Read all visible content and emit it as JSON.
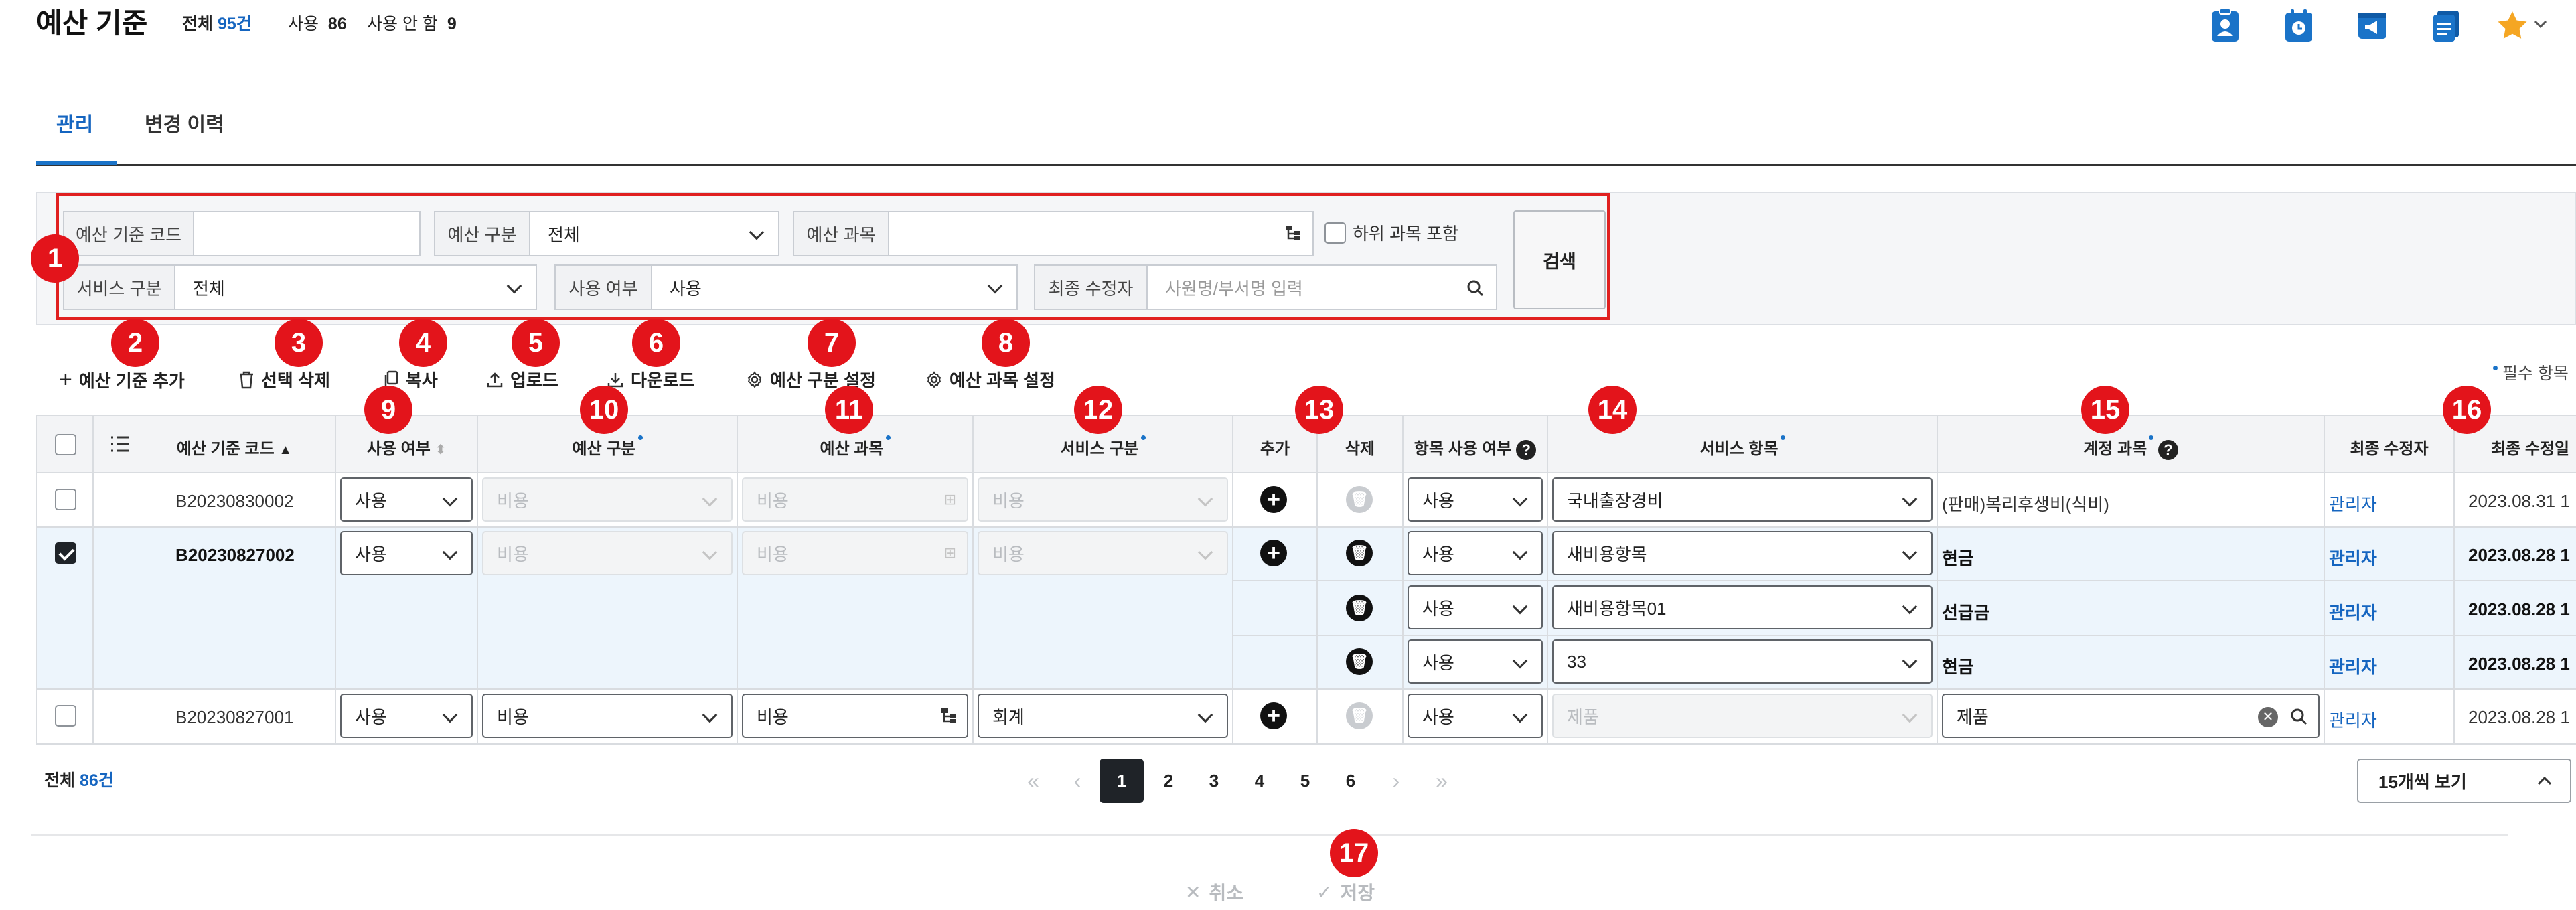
{
  "header": {
    "title": "예산 기준",
    "total_label": "전체",
    "total_value": "95건",
    "used_label": "사용",
    "used_value": "86",
    "unused_label": "사용 안 함",
    "unused_value": "9",
    "icons": [
      "person-badge-icon",
      "clock-calendar-icon",
      "megaphone-icon",
      "document-list-icon",
      "star-icon"
    ],
    "accent_color": "#1a73c8",
    "star_color": "#f5a623"
  },
  "tabs": [
    {
      "label": "관리",
      "active": true
    },
    {
      "label": "변경 이력",
      "active": false
    }
  ],
  "search": {
    "code_label": "예산 기준 코드",
    "code_value": "",
    "category_label": "예산 구분",
    "category_value": "전체",
    "account_label": "예산 과목",
    "account_value": "",
    "include_sub_label": "하위 과목 포함",
    "service_label": "서비스 구분",
    "service_value": "전체",
    "usage_label": "사용 여부",
    "usage_value": "사용",
    "modifier_label": "최종 수정자",
    "modifier_placeholder": "사원명/부서명 입력",
    "search_button": "검색"
  },
  "toolbar": {
    "add": "예산 기준 추가",
    "delete_selected": "선택 삭제",
    "copy": "복사",
    "upload": "업로드",
    "download": "다운로드",
    "category_settings": "예산 구분 설정",
    "account_settings": "예산 과목 설정",
    "required_note": "필수 항목"
  },
  "badges": [
    "1",
    "2",
    "3",
    "4",
    "5",
    "6",
    "7",
    "8",
    "9",
    "10",
    "11",
    "12",
    "13",
    "14",
    "15",
    "16",
    "17"
  ],
  "table": {
    "headers": {
      "code": "예산 기준 코드",
      "usage": "사용 여부",
      "category": "예산 구분",
      "account": "예산 과목",
      "service": "서비스 구분",
      "add": "추가",
      "delete": "삭제",
      "item_usage": "항목 사용 여부",
      "service_item": "서비스 항목",
      "gl_account": "계정 과목",
      "modifier": "최종 수정자",
      "modified_date": "최종 수정일"
    },
    "rows": [
      {
        "code": "B20230830002",
        "usage": "사용",
        "category": "비용",
        "account": "비용",
        "service": "비용",
        "item_usage": "사용",
        "service_item": "국내출장경비",
        "gl_account": "(판매)복리후생비(식비)",
        "modifier": "관리자",
        "date": "2023.08.31 1"
      },
      {
        "code": "B20230827002",
        "usage": "사용",
        "category": "비용",
        "account": "비용",
        "service": "비용",
        "item_usage": "사용",
        "service_item": "새비용항목",
        "gl_account": "현금",
        "modifier": "관리자",
        "date": "2023.08.28 1"
      },
      {
        "item_usage": "사용",
        "service_item": "새비용항목01",
        "gl_account": "선급금",
        "modifier": "관리자",
        "date": "2023.08.28 1"
      },
      {
        "item_usage": "사용",
        "service_item": "33",
        "gl_account": "현금",
        "modifier": "관리자",
        "date": "2023.08.28 1"
      },
      {
        "code": "B20230827001",
        "usage": "사용",
        "category": "비용",
        "account": "비용",
        "service": "회계",
        "item_usage": "사용",
        "service_item": "제품",
        "gl_account": "제품",
        "modifier": "관리자",
        "date": "2023.08.28 1"
      }
    ]
  },
  "footer": {
    "total_label": "전체",
    "total_value": "86건",
    "pages": [
      "1",
      "2",
      "3",
      "4",
      "5",
      "6"
    ],
    "current_page": "1",
    "per_page": "15개씩 보기",
    "cancel": "취소",
    "save": "저장"
  }
}
